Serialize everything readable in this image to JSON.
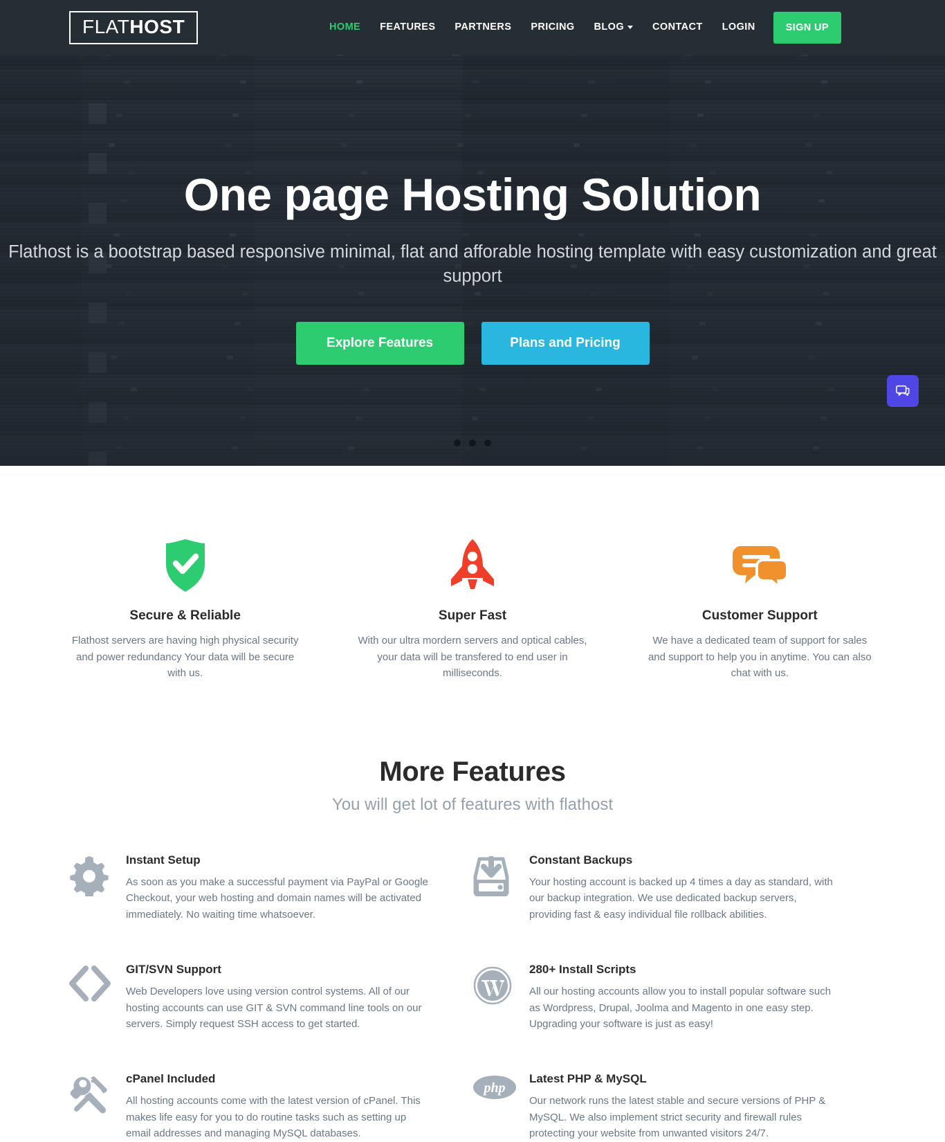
{
  "colors": {
    "navbar_bg": "#252d35",
    "accent_green": "#2ecc71",
    "accent_blue": "#29b6df",
    "accent_red": "#ef3e2a",
    "accent_orange": "#f0912d",
    "icon_grey": "#a6b0bb",
    "chat_purple": "#4f46e5",
    "body_text": "#6b7785",
    "heading_text": "#2b2b2b"
  },
  "navbar": {
    "logo": {
      "light": "FLAT",
      "bold": "HOST"
    },
    "links": [
      {
        "label": "HOME",
        "active": true,
        "caret": false
      },
      {
        "label": "FEATURES",
        "active": false,
        "caret": false
      },
      {
        "label": "PARTNERS",
        "active": false,
        "caret": false
      },
      {
        "label": "PRICING",
        "active": false,
        "caret": false
      },
      {
        "label": "BLOG",
        "active": false,
        "caret": true
      },
      {
        "label": "CONTACT",
        "active": false,
        "caret": false
      },
      {
        "label": "LOGIN",
        "active": false,
        "caret": false
      }
    ],
    "signup_label": "SIGN UP"
  },
  "hero": {
    "title": "One page Hosting Solution",
    "subtitle": "Flathost is a bootstrap based responsive minimal, flat and afforable hosting template with easy customization and great support",
    "primary_button": "Explore Features",
    "secondary_button": "Plans and Pricing",
    "carousel_dots": 3,
    "active_dot": 0,
    "chat_icon": "chat-bubble-icon"
  },
  "top_features": [
    {
      "icon": "shield-check-icon",
      "title": "Secure & Reliable",
      "desc": "Flathost servers are having high physical security and power redundancy Your data will be secure with us."
    },
    {
      "icon": "rocket-icon",
      "title": "Super Fast",
      "desc": "With our ultra mordern servers and optical cables, your data will be transfered to end user in milliseconds."
    },
    {
      "icon": "support-chat-icon",
      "title": "Customer Support",
      "desc": "We have a dedicated team of support for sales and support to help you in anytime. You can also chat with us."
    }
  ],
  "more_features": {
    "title": "More Features",
    "subtitle": "You will get lot of features with flathost",
    "items": [
      {
        "icon": "gear-icon",
        "title": "Instant Setup",
        "desc": "As soon as you make a successful payment via PayPal or Google Checkout, your web hosting and domain names will be activated immediately. No waiting time whatsoever."
      },
      {
        "icon": "backup-inbox-icon",
        "title": "Constant Backups",
        "desc": "Your hosting account is backed up 4 times a day as standard, with our backup integration. We use dedicated backup servers, providing fast & easy individual file rollback abilities."
      },
      {
        "icon": "code-brackets-icon",
        "title": "GIT/SVN Support",
        "desc": "Web Developers love using version control systems. All of our hosting accounts can use GIT & SVN command line tools on our servers. Simply request SSH access to get started."
      },
      {
        "icon": "wordpress-icon",
        "title": "280+ Install Scripts",
        "desc": "All our hosting accounts allow you to install popular software such as Wordpress, Drupal, Joolma and Magento in one easy step. Upgrading your software is just as easy!"
      },
      {
        "icon": "wrench-screwdriver-icon",
        "title": "cPanel Included",
        "desc": "All hosting accounts come with the latest version of cPanel. This makes life easy for you to do routine tasks such as setting up email addresses and managing MySQL databases."
      },
      {
        "icon": "php-icon",
        "title": "Latest PHP & MySQL",
        "desc": "Our network runs the latest stable and secure versions of PHP & MySQL. We also implement strict security and firewall rules protecting your website from unwanted visitors 24/7."
      }
    ]
  }
}
